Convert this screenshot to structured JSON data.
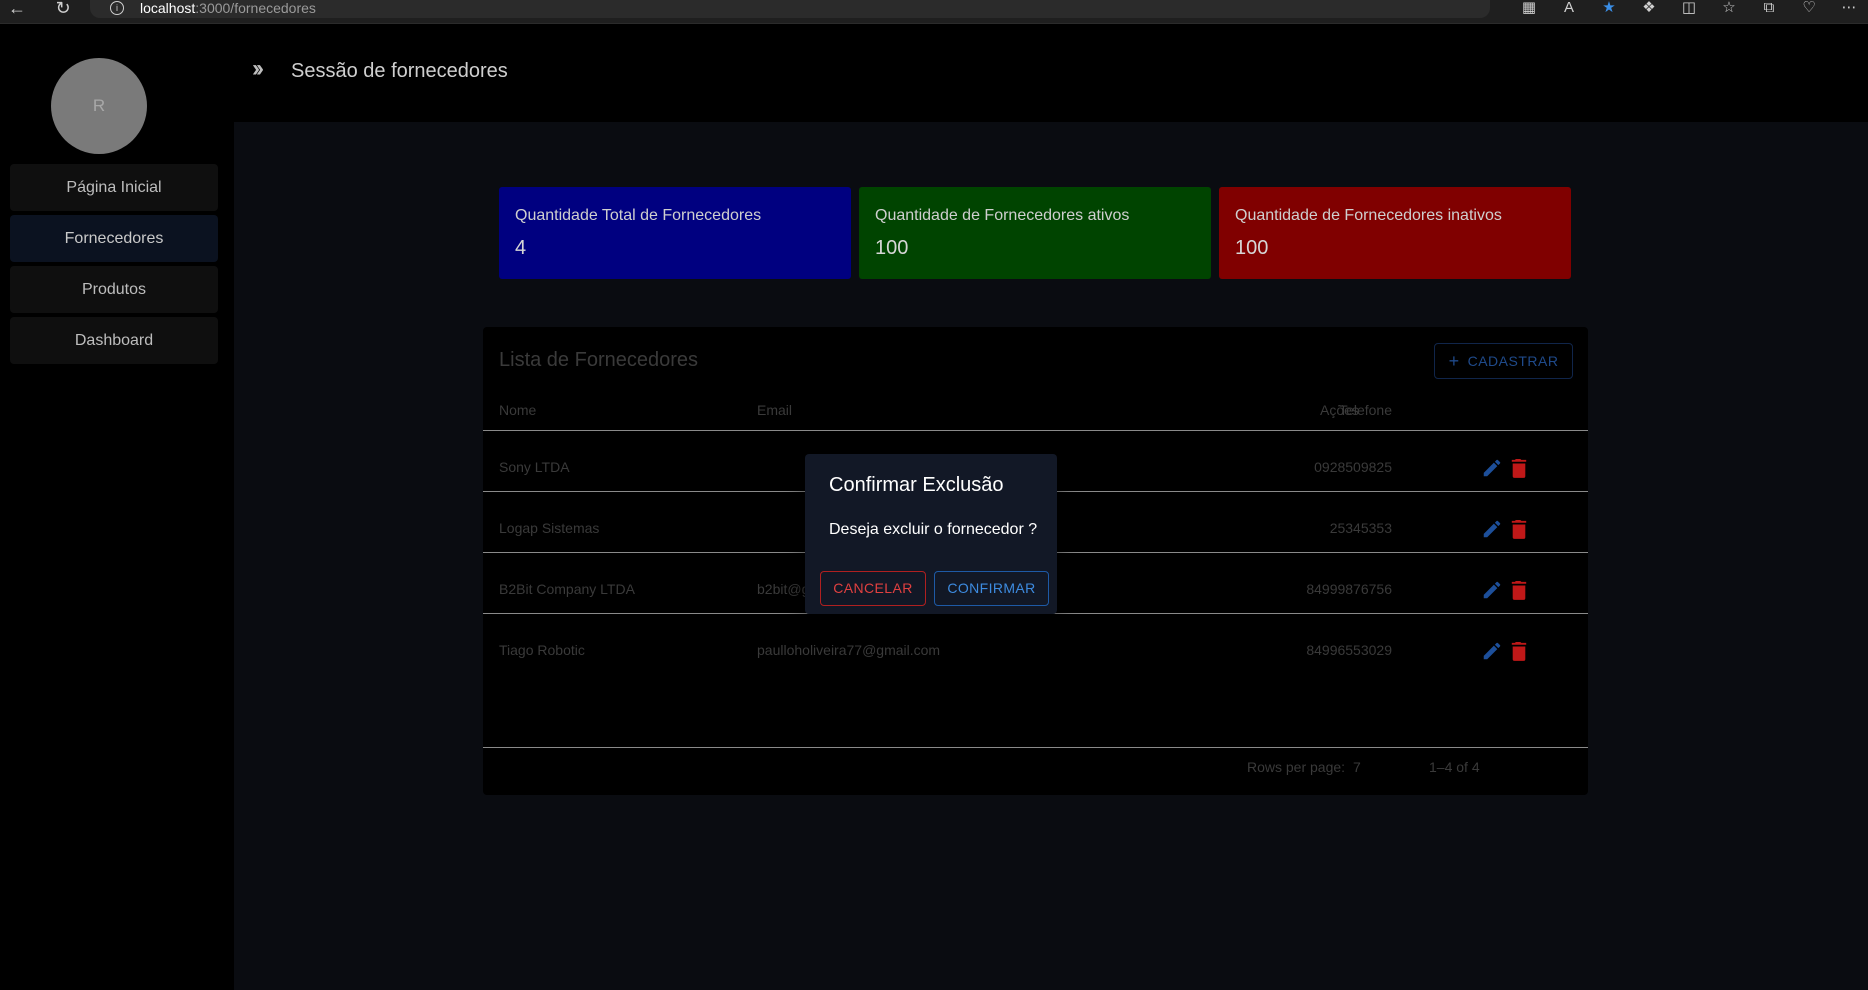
{
  "browser": {
    "url_host": "localhost",
    "url_path": ":3000/fornecedores",
    "icons": [
      "back-icon",
      "reload-icon",
      "info-icon",
      "apps-icon",
      "read-aloud-icon",
      "favorite-star-icon",
      "extensions-icon",
      "split-screen-icon",
      "favorites-icon",
      "collections-icon",
      "health-icon",
      "more-icon"
    ]
  },
  "sidebar": {
    "avatar_initial": "R",
    "items": [
      {
        "label": "Página Inicial"
      },
      {
        "label": "Fornecedores"
      },
      {
        "label": "Produtos"
      },
      {
        "label": "Dashboard"
      }
    ]
  },
  "header": {
    "title": "Sessão de fornecedores",
    "icon": "double-chevron-right-icon"
  },
  "stats": [
    {
      "label": "Quantidade Total de Fornecedores",
      "value": "4",
      "color": "#000080"
    },
    {
      "label": "Quantidade de Fornecedores ativos",
      "value": "100",
      "color": "#004400"
    },
    {
      "label": "Quantidade de Fornecedores inativos",
      "value": "100",
      "color": "#800000"
    }
  ],
  "table": {
    "title": "Lista de Fornecedores",
    "add_button": "CADASTRAR",
    "headers": {
      "name": "Nome",
      "email": "Email",
      "phone": "Telefone",
      "actions": "Ações"
    },
    "rows": [
      {
        "name": "Sony LTDA",
        "email": "",
        "phone": "0928509825"
      },
      {
        "name": "Logap Sistemas",
        "email": "",
        "phone": "25345353"
      },
      {
        "name": "B2Bit Company LTDA",
        "email": "b2bit@gmail.com",
        "phone": "84999876756"
      },
      {
        "name": "Tiago Robotic",
        "email": "paulloholiveira77@gmail.com",
        "phone": "84996553029"
      }
    ],
    "pagination": {
      "rows_per_page_label": "Rows per page:",
      "rows_per_page": "7",
      "range": "1–4 of 4"
    }
  },
  "modal": {
    "title": "Confirmar Exclusão",
    "message": "Deseja excluir o fornecedor ?",
    "cancel": "CANCELAR",
    "confirm": "CONFIRMAR"
  },
  "colors": {
    "accent_blue": "#1e5aa6",
    "danger_red": "#c01818",
    "edit_blue": "#1d4f9a"
  }
}
